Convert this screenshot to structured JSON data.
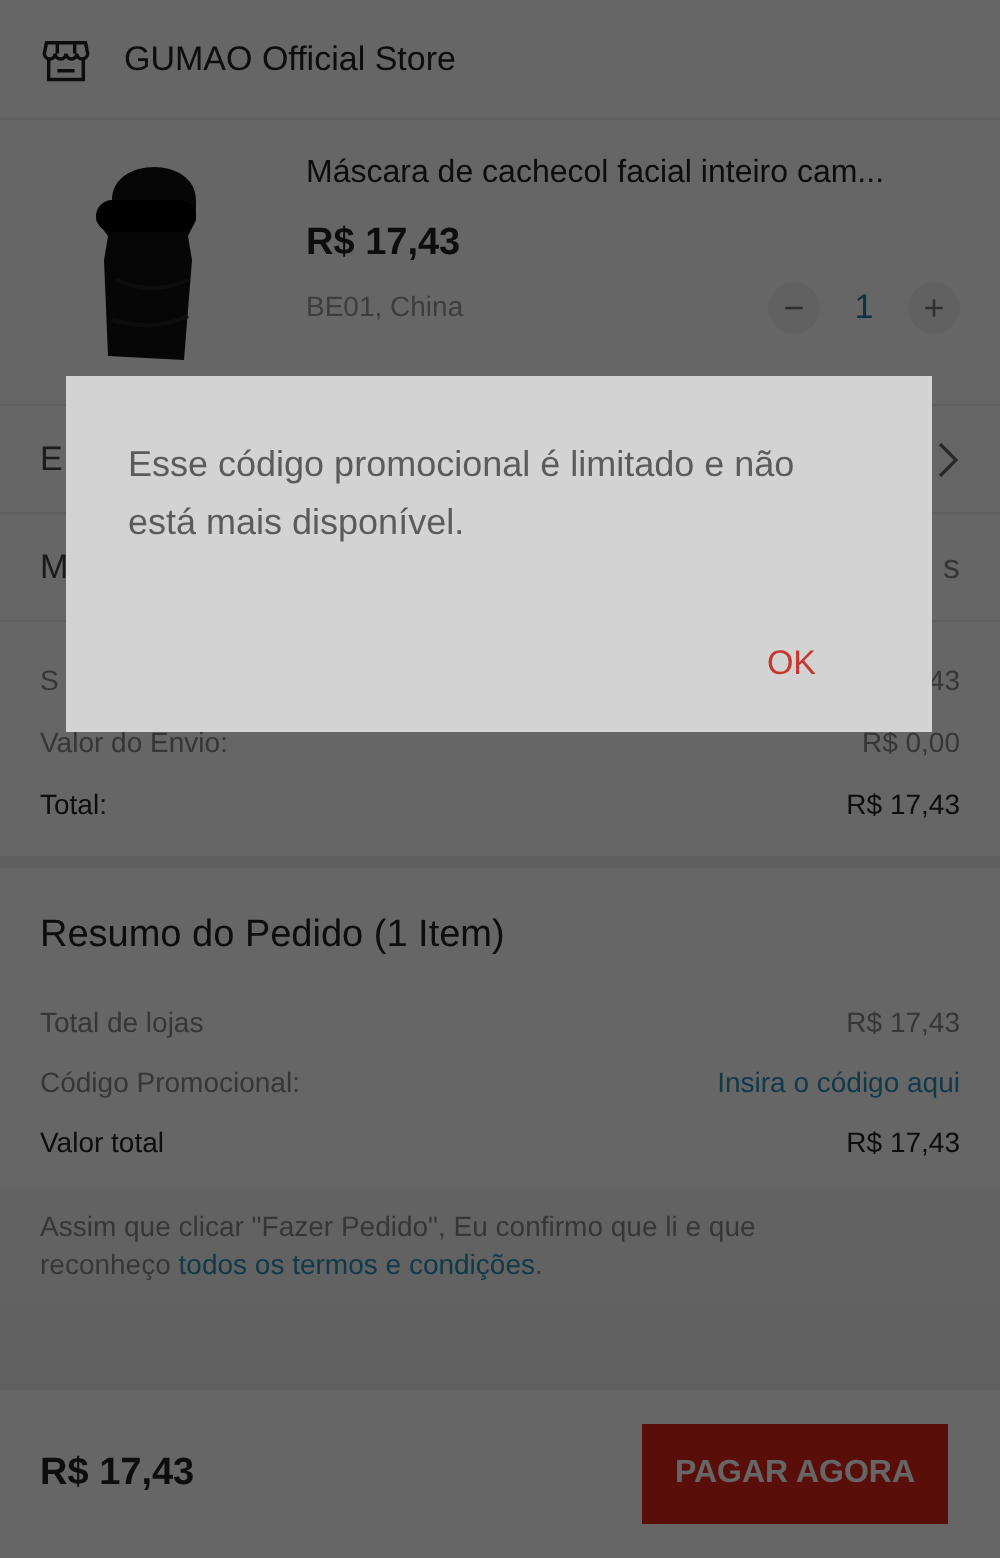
{
  "store": {
    "name": "GUMAO Official Store"
  },
  "product": {
    "title": "Máscara de cachecol facial inteiro cam...",
    "price": "R$ 17,43",
    "location": "BE01, China",
    "decrease": "−",
    "quantity": "1",
    "increase": "+"
  },
  "partial_rows": [
    {
      "label": "E",
      "value": "",
      "chevron": true
    },
    {
      "label": "M",
      "value": "s",
      "chevron": false
    }
  ],
  "costs": [
    {
      "label": "S",
      "value": "43",
      "kind": "muted"
    },
    {
      "label": "Valor do Envio:",
      "value": "R$ 0,00",
      "kind": "muted"
    },
    {
      "label": "Total:",
      "value": "R$ 17,43",
      "kind": "strong"
    }
  ],
  "summary": {
    "title": "Resumo do Pedido (1 Item)",
    "rows": [
      {
        "label": "Total de lojas",
        "value": "R$ 17,43",
        "kind": "muted"
      },
      {
        "label": "Código Promocional:",
        "value": "Insira o código aqui",
        "kind": "link"
      },
      {
        "label": "Valor total",
        "value": "R$ 17,43",
        "kind": "strong"
      }
    ]
  },
  "terms": {
    "text": "Assim que clicar \"Fazer Pedido\", Eu confirmo que li e que reconheço",
    "link": "todos os termos e condições",
    "end": "."
  },
  "footer": {
    "total": "R$ 17,43",
    "pay_button": "PAGAR AGORA"
  },
  "dialog": {
    "message": "Esse código promocional é limitado e não está mais disponível.",
    "ok": "OK"
  }
}
